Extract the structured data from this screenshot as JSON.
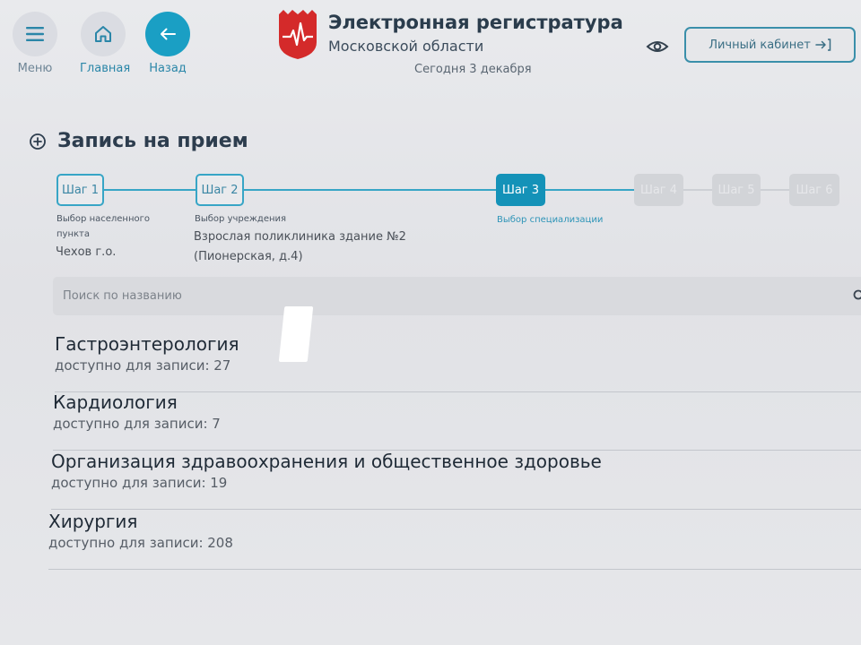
{
  "header": {
    "nav": [
      {
        "id": "menu",
        "label": "Меню",
        "icon": "hamburger-icon"
      },
      {
        "id": "home",
        "label": "Главная",
        "icon": "home-icon"
      },
      {
        "id": "back",
        "label": "Назад",
        "icon": "arrow-left-icon"
      }
    ],
    "brand_title": "Электронная регистратура",
    "brand_subtitle": "Московской области",
    "today": "Сегодня 3 декабря",
    "cabinet_label": "Личный кабинет",
    "colors": {
      "accent": "#1a9fc4",
      "logo_red": "#d42a2a"
    }
  },
  "page_title": "Запись на прием",
  "steps": [
    {
      "label": "Шаг 1",
      "state": "done",
      "caption": "Выбор населенного",
      "caption2": "пункта",
      "value": "Чехов г.о."
    },
    {
      "label": "Шаг 2",
      "state": "done",
      "caption": "Выбор учреждения",
      "value": "Взрослая поликлиника здание №2",
      "value2": "(Пионерская, д.4)"
    },
    {
      "label": "Шаг 3",
      "state": "active",
      "caption": "Выбор специализации"
    },
    {
      "label": "Шаг 4",
      "state": "future"
    },
    {
      "label": "Шаг 5",
      "state": "future"
    },
    {
      "label": "Шаг 6",
      "state": "future"
    }
  ],
  "search": {
    "placeholder": "Поиск по названию",
    "value": ""
  },
  "specialties": [
    {
      "name": "Гастроэнтерология",
      "count_text": "доступно для записи: 27"
    },
    {
      "name": "Кардиология",
      "count_text": "доступно для записи: 7"
    },
    {
      "name": "Организация здравоохранения и общественное здоровье",
      "count_text": "доступно для записи: 19"
    },
    {
      "name": "Хирургия",
      "count_text": "доступно для записи: 208"
    }
  ]
}
